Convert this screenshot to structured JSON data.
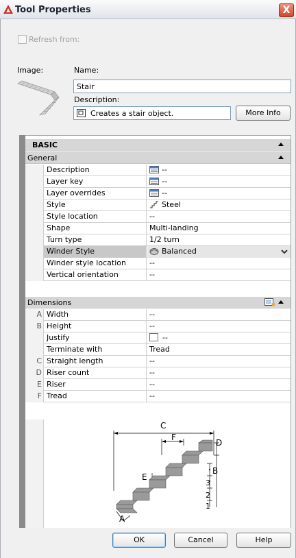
{
  "window": {
    "title": "Tool Properties",
    "close_label": "X"
  },
  "refresh": {
    "label": "Refresh from:"
  },
  "image_label": "Image:",
  "name": {
    "label": "Name:",
    "value": "Stair"
  },
  "description": {
    "label": "Description:",
    "value": "Creates a stair object."
  },
  "more_info_label": "More Info",
  "basic": {
    "title": "BASIC"
  },
  "general": {
    "title": "General",
    "rows": [
      {
        "name": "Description",
        "value": "--",
        "icon": "list-icon"
      },
      {
        "name": "Layer key",
        "value": "--",
        "icon": "list-icon"
      },
      {
        "name": "Layer overrides",
        "value": "--",
        "icon": "list-icon"
      },
      {
        "name": "Style",
        "value": "Steel",
        "icon": "stair-style-icon"
      },
      {
        "name": "Style location",
        "value": "--"
      },
      {
        "name": "Shape",
        "value": "Multi-landing"
      },
      {
        "name": "Turn type",
        "value": "1/2 turn"
      },
      {
        "name": "Winder Style",
        "value": "Balanced",
        "icon": "winder-icon"
      },
      {
        "name": "Winder style location",
        "value": "--"
      },
      {
        "name": "Vertical orientation",
        "value": "--"
      }
    ]
  },
  "dimensions": {
    "title": "Dimensions",
    "rows": [
      {
        "letter": "A",
        "name": "Width",
        "value": "--"
      },
      {
        "letter": "B",
        "name": "Height",
        "value": "--"
      },
      {
        "letter": "",
        "name": "Justify",
        "value": "--"
      },
      {
        "letter": "",
        "name": "Terminate with",
        "value": "Tread"
      },
      {
        "letter": "C",
        "name": "Straight length",
        "value": "--"
      },
      {
        "letter": "D",
        "name": "Riser count",
        "value": "--"
      },
      {
        "letter": "E",
        "name": "Riser",
        "value": "--"
      },
      {
        "letter": "F",
        "name": "Tread",
        "value": "--"
      }
    ]
  },
  "diagram_labels": {
    "c": "C",
    "f": "F",
    "d": "D",
    "e": "E",
    "b": "B",
    "a": "A",
    "n3": "3",
    "n2": "2",
    "n1": "1"
  },
  "buttons": {
    "ok": "OK",
    "cancel": "Cancel",
    "help": "Help"
  },
  "colors": {
    "accent_red": "#d2462c",
    "selected_row": "#c8c8c8",
    "panel_header": "#d6d6d6"
  }
}
